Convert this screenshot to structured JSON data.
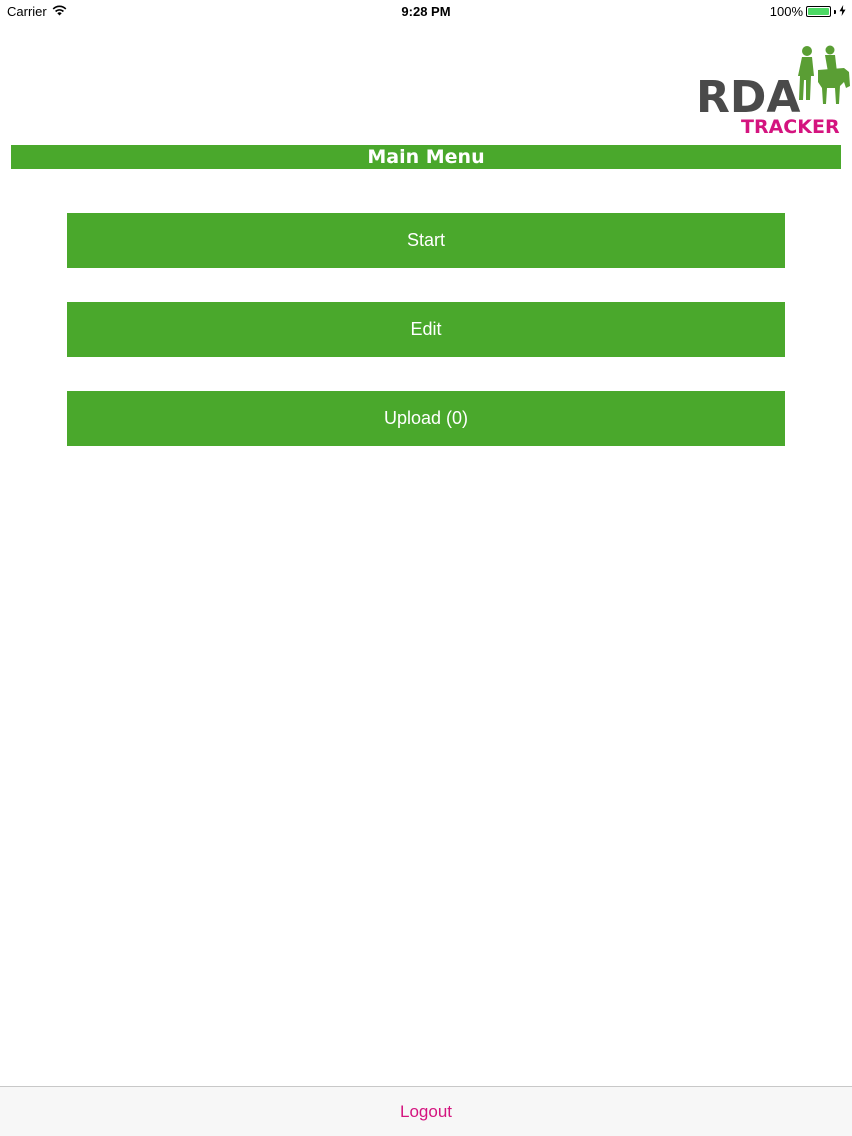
{
  "status_bar": {
    "carrier": "Carrier",
    "time": "9:28 PM",
    "battery": "100%"
  },
  "logo": {
    "primary": "RDA",
    "secondary": "TRACKER"
  },
  "header": {
    "title": "Main Menu"
  },
  "menu": {
    "start_label": "Start",
    "edit_label": "Edit",
    "upload_label": "Upload (0)"
  },
  "toolbar": {
    "logout_label": "Logout"
  },
  "colors": {
    "accent_green": "#4aa82c",
    "logo_green": "#5a9e34",
    "logo_pink": "#d4147f",
    "logo_grey": "#4a4a4a"
  }
}
